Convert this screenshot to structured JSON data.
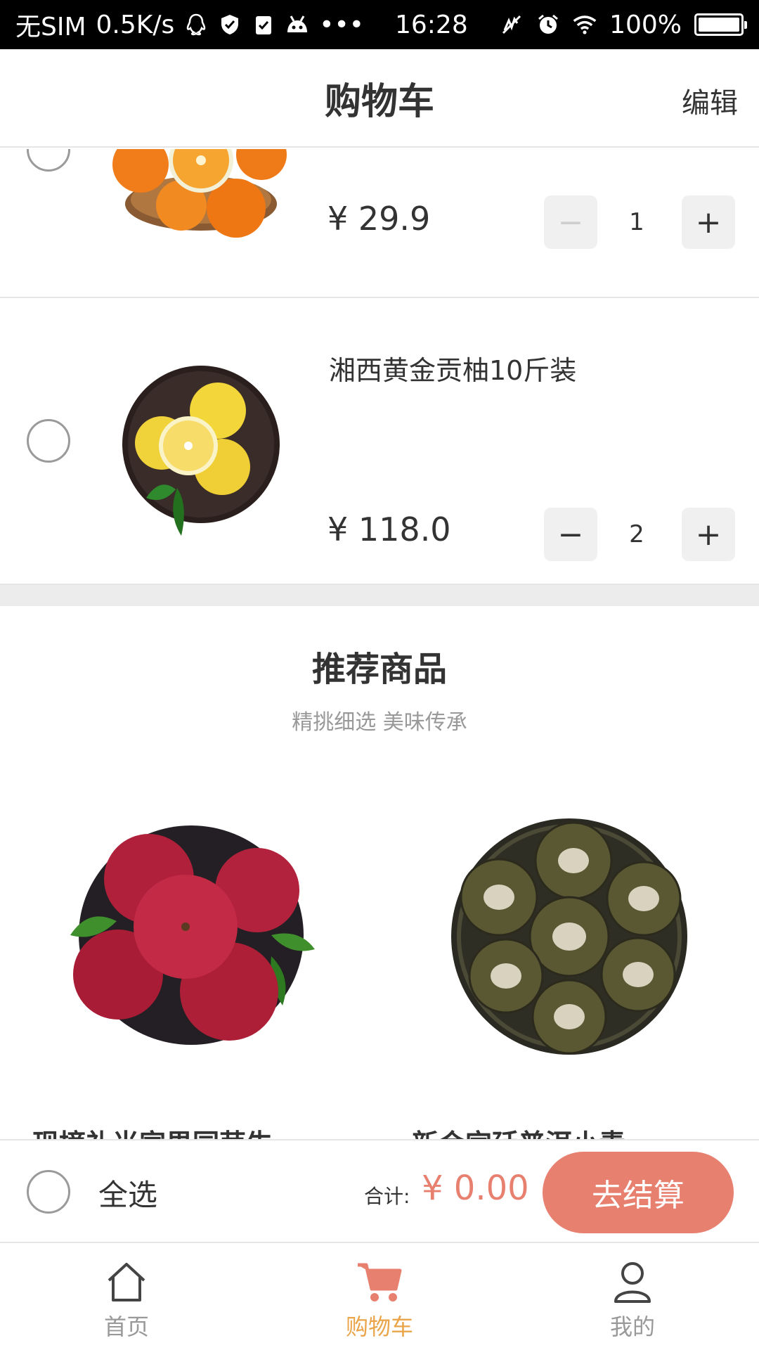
{
  "status_bar": {
    "carrier": "无SIM",
    "speed": "0.5K/s",
    "time": "16:28",
    "battery": "100%",
    "battery_level": 1.0
  },
  "header": {
    "title": "购物车",
    "edit_label": "编辑"
  },
  "cart_items": [
    {
      "name": "",
      "price": "¥ 29.9",
      "quantity": "1",
      "decrement_label": "−",
      "increment_label": "+",
      "decrement_disabled": true,
      "image": "oranges-in-bowl"
    },
    {
      "name": "湘西黄金贡柚10斤装",
      "price": "¥ 118.0",
      "quantity": "2",
      "decrement_label": "−",
      "increment_label": "+",
      "decrement_disabled": false,
      "image": "pomelos-on-plate"
    }
  ],
  "recommend": {
    "title": "推荐商品",
    "subtitle": "精挑细选 美味传承",
    "products": [
      {
        "name": "现摘礼当家果园苹牛…",
        "image": "red-apples-on-plate"
      },
      {
        "name": "新会宫廷普洱小青…",
        "image": "tangerine-puer-tea-balls"
      }
    ]
  },
  "action_bar": {
    "select_all_label": "全选",
    "total_label": "合计:",
    "total_value": "¥ 0.00",
    "checkout_label": "去结算"
  },
  "tab_bar": {
    "tabs": [
      {
        "label": "首页",
        "icon": "home-icon",
        "active": false
      },
      {
        "label": "购物车",
        "icon": "cart-icon",
        "active": true
      },
      {
        "label": "我的",
        "icon": "user-icon",
        "active": false
      }
    ]
  },
  "colors": {
    "accent": "#e8806f",
    "tab_active": "#eaa54a",
    "text": "#333333",
    "muted": "#999999"
  }
}
